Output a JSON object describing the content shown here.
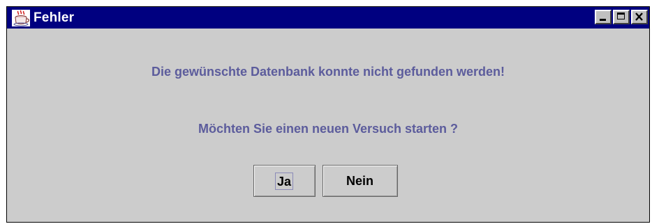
{
  "window": {
    "title": "Fehler",
    "app_icon": "java-coffee-cup-icon",
    "controls": {
      "minimize": "minimize-icon",
      "maximize": "maximize-icon",
      "close": "close-icon"
    }
  },
  "dialog": {
    "message": "Die gewünschte Datenbank konnte nicht gefunden werden!",
    "question": "Möchten Sie einen neuen Versuch starten ?",
    "buttons": {
      "yes_label": "Ja",
      "no_label": "Nein"
    }
  },
  "colors": {
    "titlebar": "#000080",
    "background": "#cccccc",
    "message_text": "#5c5c9c"
  }
}
